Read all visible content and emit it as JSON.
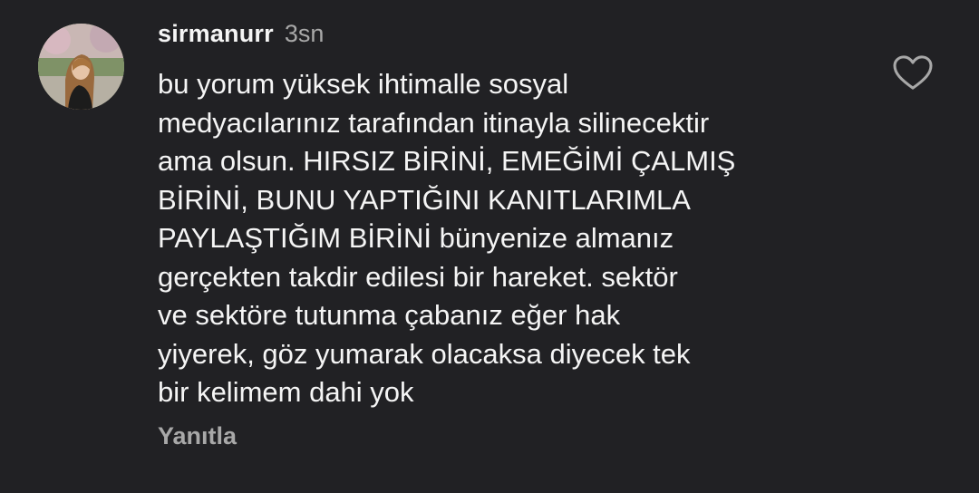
{
  "comment": {
    "username": "sirmanurr",
    "time": "3sn",
    "lines": [
      "bu yorum yüksek ihtimalle sosyal",
      "medyacılarınız tarafından itinayla silinecektir",
      "ama olsun. HIRSIZ BİRİNİ, EMEĞİMİ ÇALMIŞ",
      "BİRİNİ, BUNU YAPTIĞINI KANITLARIMLA",
      "PAYLAŞTIĞIM BİRİNİ bünyenize almanız",
      "gerçekten takdir edilesi bir hareket. sektör",
      "ve sektöre tutunma çabanız eğer hak",
      "yiyerek, göz yumarak olacaksa diyecek tek",
      "bir kelimem dahi yok"
    ],
    "reply_label": "Yanıtla",
    "like_icon": "heart-outline-icon",
    "avatar_icon": "profile-photo"
  },
  "colors": {
    "background": "#212124",
    "text": "#f5f5f5",
    "muted": "#a8a8a8"
  }
}
